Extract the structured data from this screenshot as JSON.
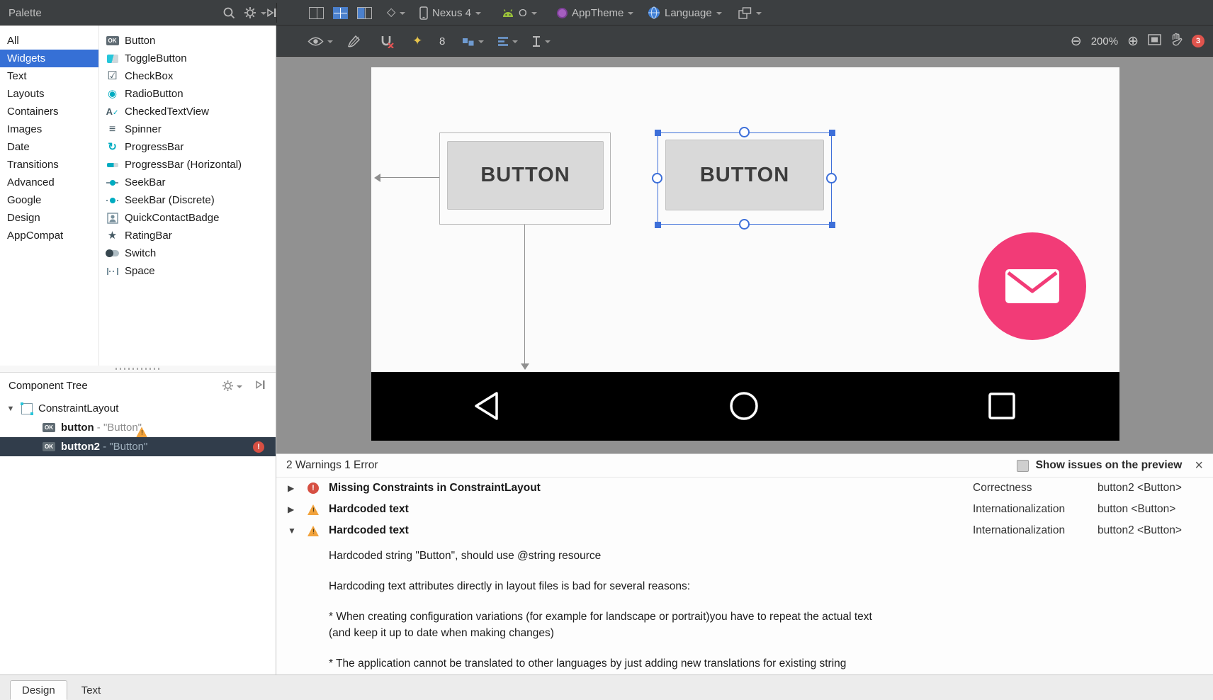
{
  "icons": {
    "zoom_out": "⊖",
    "zoom_in": "⊕",
    "close": "×",
    "collapsed_arrow": "▶",
    "expanded_arrow": "▼",
    "checkbox_glyph": "☑",
    "radio_glyph": "◉",
    "spinner_glyph": "≡",
    "progress_glyph": "↻",
    "star_glyph": "★",
    "orientation_glyph": "◇",
    "sparkle_glyph": "✦",
    "letter_a": "A",
    "check": "✓",
    "ok_badge": "OK",
    "warning_mark": "!",
    "error_mark": "!"
  },
  "top_toolbar": {
    "palette_label": "Palette",
    "device_label": "Nexus 4",
    "api_label": "O",
    "theme_label": "AppTheme",
    "language_label": "Language"
  },
  "design_toolbar": {
    "default_margin": "8",
    "zoom_level": "200%",
    "error_badge": "3"
  },
  "palette": {
    "categories": [
      "All",
      "Widgets",
      "Text",
      "Layouts",
      "Containers",
      "Images",
      "Date",
      "Transitions",
      "Advanced",
      "Google",
      "Design",
      "AppCompat"
    ],
    "selected_category": "Widgets",
    "components": [
      "Button",
      "ToggleButton",
      "CheckBox",
      "RadioButton",
      "CheckedTextView",
      "Spinner",
      "ProgressBar",
      "ProgressBar (Horizontal)",
      "SeekBar",
      "SeekBar (Discrete)",
      "QuickContactBadge",
      "RatingBar",
      "Switch",
      "Space"
    ]
  },
  "component_tree": {
    "title": "Component Tree",
    "nodes": [
      {
        "label": "ConstraintLayout"
      },
      {
        "id": "button",
        "suffix": " - \"Button\"",
        "badge": "warning"
      },
      {
        "id": "button2",
        "suffix": " - \"Button\"",
        "badge": "error",
        "selected": true
      }
    ]
  },
  "canvas": {
    "button1_label": "BUTTON",
    "button2_label": "BUTTON"
  },
  "issues": {
    "header": "2 Warnings 1 Error",
    "show_issues_label": "Show issues on the preview",
    "rows": [
      {
        "severity": "error",
        "title": "Missing Constraints in ConstraintLayout",
        "category": "Correctness",
        "component": "button2 <Button>",
        "expanded": false
      },
      {
        "severity": "warning",
        "title": "Hardcoded text",
        "category": "Internationalization",
        "component": "button <Button>",
        "expanded": false
      },
      {
        "severity": "warning",
        "title": "Hardcoded text",
        "category": "Internationalization",
        "component": "button2 <Button>",
        "expanded": true
      }
    ],
    "detail_lines": [
      "Hardcoded string \"Button\", should use @string resource",
      "Hardcoding text attributes directly in layout files is bad for several reasons:",
      "* When creating configuration variations (for example for landscape or portrait)you have to repeat the actual text",
      "(and keep it up to date when making changes)",
      "* The application cannot be translated to other languages by just adding new translations for existing string"
    ]
  },
  "bottom_tabs": {
    "design": "Design",
    "text": "Text"
  },
  "colors": {
    "accent_pink": "#f23b77",
    "selection_blue": "#3d6fd9",
    "error_red": "#d64f42",
    "warning_amber": "#f2a33c",
    "canvas_gray": "#919191"
  }
}
